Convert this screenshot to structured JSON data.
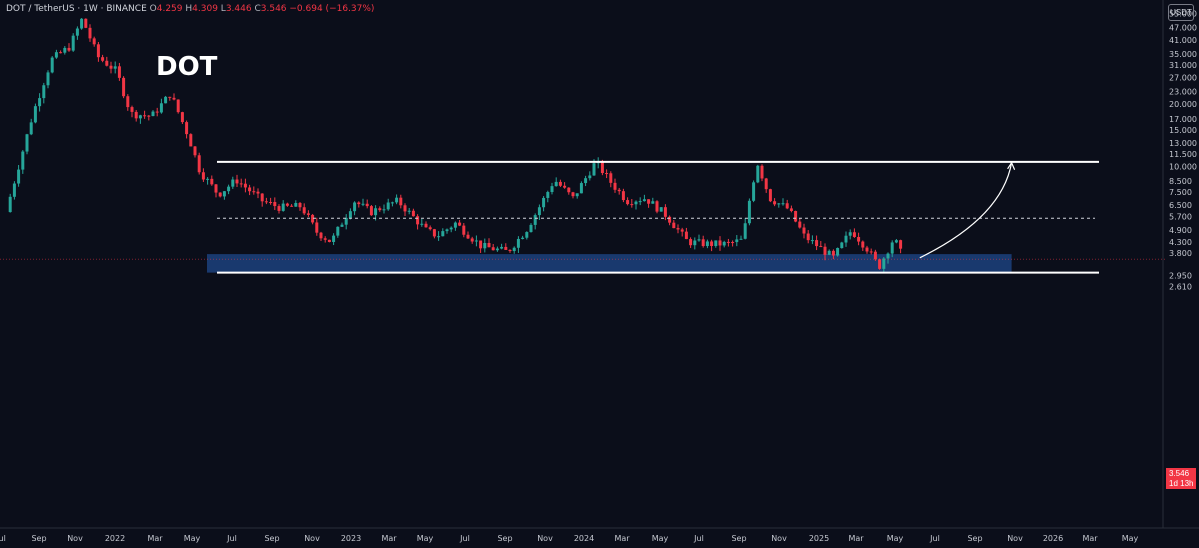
{
  "header": {
    "symbol": "DOT / TetherUS · 1W · BINANCE",
    "o_label": "O",
    "o_value": "4.259",
    "h_label": "H",
    "h_value": "4.309",
    "l_label": "L",
    "l_value": "3.446",
    "c_label": "C",
    "c_value": "3.546",
    "change": "−0.694 (−16.37%)"
  },
  "ticker_title": "DOT",
  "currency_badge": "USDT",
  "current_price": {
    "value": "3.546",
    "countdown": "1d 13h"
  },
  "colors": {
    "background": "#0b0e1a",
    "up": "#26a69a",
    "down": "#f23645",
    "zone": "#1e4b8f",
    "line": "#ffffff"
  },
  "chart_data": {
    "type": "candlestick",
    "title": "DOT",
    "y_scale": "log",
    "y_ticks": [
      "55.000",
      "47.000",
      "41.000",
      "35.000",
      "31.000",
      "27.000",
      "23.000",
      "20.000",
      "17.000",
      "15.000",
      "13.000",
      "11.500",
      "10.000",
      "8.500",
      "7.500",
      "6.500",
      "5.700",
      "4.900",
      "4.300",
      "3.800",
      "2.950",
      "2.610"
    ],
    "x_ticks": [
      "Jul",
      "Sep",
      "Nov",
      "2022",
      "Mar",
      "May",
      "Jul",
      "Sep",
      "Nov",
      "2023",
      "Mar",
      "May",
      "Jul",
      "Sep",
      "Nov",
      "2024",
      "Mar",
      "May",
      "Jul",
      "Sep",
      "Nov",
      "2025",
      "Mar",
      "May",
      "Jul",
      "Sep",
      "Nov",
      "2026",
      "Mar",
      "May"
    ],
    "resistance_level": 10.5,
    "mid_level": 5.6,
    "support_level": 3.05,
    "demand_zone": {
      "low": 3.05,
      "high": 3.75,
      "from": "2022-06",
      "to": "2026-02"
    },
    "projection": {
      "from_price": 3.6,
      "to_price": 10.4,
      "from": "2025-09",
      "to": "2026-02"
    },
    "path": [
      {
        "d": "2021-07-01",
        "p": 6.0
      },
      {
        "d": "2021-08-15",
        "p": 18.0
      },
      {
        "d": "2021-09-15",
        "p": 33.0
      },
      {
        "d": "2021-10-15",
        "p": 38.0
      },
      {
        "d": "2021-11-05",
        "p": 52.0
      },
      {
        "d": "2021-12-01",
        "p": 34.0
      },
      {
        "d": "2022-01-01",
        "p": 29.0
      },
      {
        "d": "2022-01-25",
        "p": 18.0
      },
      {
        "d": "2022-03-01",
        "p": 17.5
      },
      {
        "d": "2022-04-01",
        "p": 22.5
      },
      {
        "d": "2022-05-01",
        "p": 14.0
      },
      {
        "d": "2022-05-20",
        "p": 9.5
      },
      {
        "d": "2022-06-20",
        "p": 7.3
      },
      {
        "d": "2022-07-20",
        "p": 8.6
      },
      {
        "d": "2022-09-01",
        "p": 6.8
      },
      {
        "d": "2022-10-01",
        "p": 6.3
      },
      {
        "d": "2022-11-05",
        "p": 6.4
      },
      {
        "d": "2022-12-01",
        "p": 4.8
      },
      {
        "d": "2022-12-25",
        "p": 4.3
      },
      {
        "d": "2023-02-01",
        "p": 6.8
      },
      {
        "d": "2023-03-01",
        "p": 6.0
      },
      {
        "d": "2023-04-15",
        "p": 6.8
      },
      {
        "d": "2023-06-01",
        "p": 4.9
      },
      {
        "d": "2023-06-20",
        "p": 4.6
      },
      {
        "d": "2023-07-20",
        "p": 5.3
      },
      {
        "d": "2023-09-01",
        "p": 4.1
      },
      {
        "d": "2023-10-15",
        "p": 3.85
      },
      {
        "d": "2023-11-15",
        "p": 4.9
      },
      {
        "d": "2023-12-05",
        "p": 6.2
      },
      {
        "d": "2024-01-01",
        "p": 8.6
      },
      {
        "d": "2024-02-01",
        "p": 7.0
      },
      {
        "d": "2024-03-10",
        "p": 10.5
      },
      {
        "d": "2024-04-05",
        "p": 8.3
      },
      {
        "d": "2024-05-01",
        "p": 6.8
      },
      {
        "d": "2024-06-01",
        "p": 7.0
      },
      {
        "d": "2024-07-05",
        "p": 5.8
      },
      {
        "d": "2024-08-10",
        "p": 4.3
      },
      {
        "d": "2024-09-15",
        "p": 4.2
      },
      {
        "d": "2024-10-15",
        "p": 4.2
      },
      {
        "d": "2024-11-10",
        "p": 4.4
      },
      {
        "d": "2024-11-25",
        "p": 8.0
      },
      {
        "d": "2024-12-05",
        "p": 10.3
      },
      {
        "d": "2024-12-25",
        "p": 7.0
      },
      {
        "d": "2025-01-25",
        "p": 6.2
      },
      {
        "d": "2025-02-20",
        "p": 4.6
      },
      {
        "d": "2025-03-15",
        "p": 4.1
      },
      {
        "d": "2025-04-10",
        "p": 3.6
      },
      {
        "d": "2025-05-10",
        "p": 4.9
      },
      {
        "d": "2025-06-05",
        "p": 4.0
      },
      {
        "d": "2025-06-25",
        "p": 3.25
      },
      {
        "d": "2025-07-20",
        "p": 4.5
      },
      {
        "d": "2025-08-05",
        "p": 3.55
      }
    ]
  }
}
